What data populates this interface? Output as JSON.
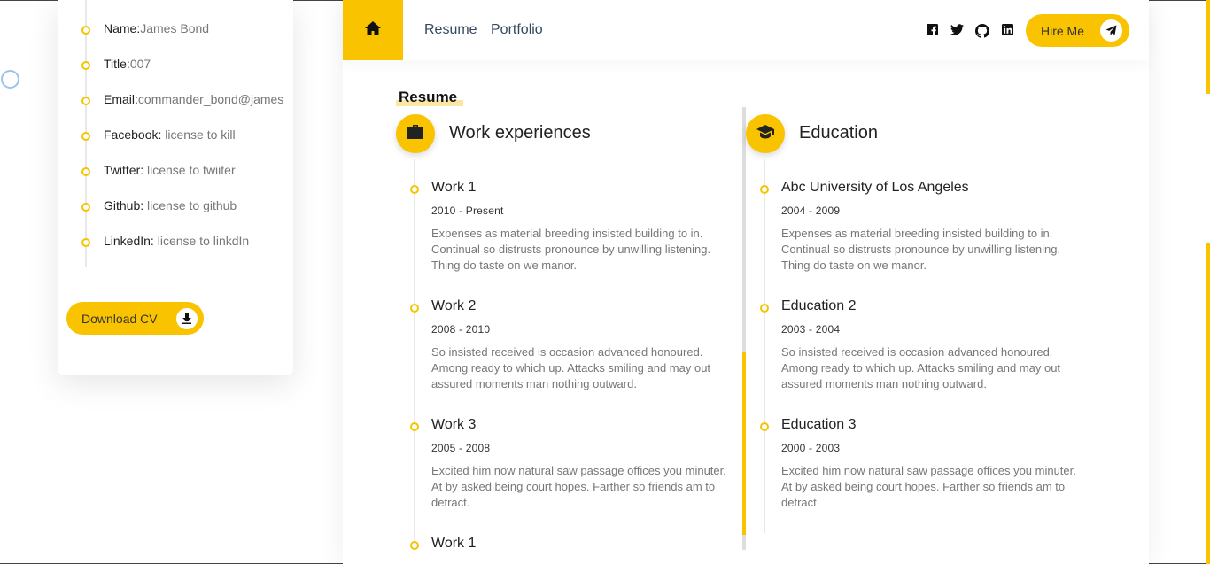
{
  "sidebar": {
    "info": [
      {
        "label": "Name:",
        "value": "James Bond"
      },
      {
        "label": "Title:",
        "value": "007"
      },
      {
        "label": "Email:",
        "value": "commander_bond@james"
      },
      {
        "label": "Facebook:",
        "value": " license to kill"
      },
      {
        "label": "Twitter:",
        "value": " license to twiiter"
      },
      {
        "label": "Github:",
        "value": " license to github"
      },
      {
        "label": "LinkedIn:",
        "value": " license to linkdIn"
      }
    ],
    "download_label": "Download CV"
  },
  "nav": {
    "links": [
      "Resume",
      "Portfolio"
    ],
    "social_icons": [
      "facebook-icon",
      "twitter-icon",
      "github-icon",
      "linkedin-icon"
    ],
    "hire_label": "Hire Me"
  },
  "resume": {
    "section_title": "Resume",
    "work": {
      "title": "Work experiences",
      "entries": [
        {
          "title": "Work 1",
          "date": "2010 - Present",
          "desc": "Expenses as material breeding insisted building to in. Continual so distrusts pronounce by unwilling listening. Thing do taste on we manor."
        },
        {
          "title": "Work 2",
          "date": "2008 - 2010",
          "desc": "So insisted received is occasion advanced honoured. Among ready to which up. Attacks smiling and may out assured moments man nothing outward."
        },
        {
          "title": "Work 3",
          "date": "2005 - 2008",
          "desc": "Excited him now natural saw passage offices you minuter. At by asked being court hopes. Farther so friends am to detract."
        },
        {
          "title": "Work 1"
        }
      ]
    },
    "education": {
      "title": "Education",
      "entries": [
        {
          "title": "Abc University of Los Angeles",
          "date": "2004 - 2009",
          "desc": "Expenses as material breeding insisted building to in. Continual so distrusts pronounce by unwilling listening. Thing do taste on we manor."
        },
        {
          "title": "Education 2",
          "date": "2003 - 2004",
          "desc": "So insisted received is occasion advanced honoured. Among ready to which up. Attacks smiling and may out assured moments man nothing outward."
        },
        {
          "title": "Education 3",
          "date": "2000 - 2003",
          "desc": "Excited him now natural saw passage offices you minuter. At by asked being court hopes. Farther so friends am to detract."
        }
      ]
    }
  },
  "colors": {
    "accent": "#f9c300",
    "muted_text": "#777777"
  }
}
